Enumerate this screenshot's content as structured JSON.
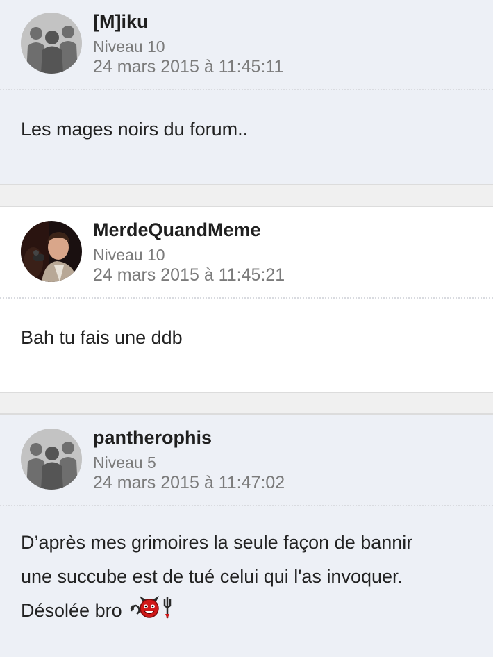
{
  "posts": [
    {
      "author": "[M]iku",
      "level": "Niveau 10",
      "date": "24 mars 2015 à 11:45:11",
      "avatar": "default-silhouette-avatar",
      "lines": [
        "Les mages noirs du forum.."
      ]
    },
    {
      "author": "MerdeQuandMeme",
      "level": "Niveau 10",
      "date": "24 mars 2015 à 11:45:21",
      "avatar": "photo-avatar",
      "lines": [
        "Bah tu fais une ddb"
      ]
    },
    {
      "author": "pantherophis",
      "level": "Niveau 5",
      "date": "24 mars 2015 à 11:47:02",
      "avatar": "default-silhouette-avatar",
      "lines": [
        "D’après mes grimoires la seule façon de bannir",
        "une succube est de tué celui qui l'as invoquer.",
        "Désolée bro"
      ],
      "trailing_emoji": [
        "devil-tail-icon",
        "devil-face-icon",
        "trident-icon"
      ]
    }
  ],
  "colors": {
    "post_bg_alt": "#edf0f6",
    "post_bg_white": "#ffffff",
    "separator": "#f0f0f0",
    "author": "#1f1f1f",
    "meta": "#7b7b7b",
    "devil_red": "#d01818"
  }
}
